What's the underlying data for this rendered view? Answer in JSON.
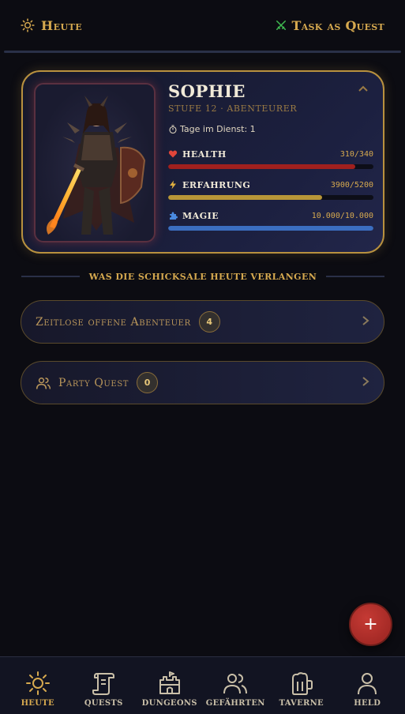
{
  "topbar": {
    "left_label": "Heute",
    "left_icon": "sun-icon",
    "right_label": "Task as Quest",
    "right_icon": "crossed-swords-icon"
  },
  "hero": {
    "name": "SOPHIE",
    "subtitle": "STUFE 12 · ABENTEURER",
    "days_label": "Tage im Dienst: 1",
    "collapse_icon": "chevron-up-icon",
    "stats": [
      {
        "label": "HEALTH",
        "value": "310/340",
        "fraction": 0.91,
        "color": "#a0201e",
        "icon": "heart-icon"
      },
      {
        "label": "ERFAHRUNG",
        "value": "3900/5200",
        "fraction": 0.75,
        "color": "#b89638",
        "icon": "lightning-icon"
      },
      {
        "label": "MAGIE",
        "value": "10.000/10.000",
        "fraction": 1.0,
        "color": "#3b6ec0",
        "icon": "puzzle-icon"
      }
    ]
  },
  "section_title": "WAS DIE SCHICKSALE HEUTE VERLANGEN",
  "adventures": {
    "label": "Zeitlose offene Abenteuer",
    "count": "4"
  },
  "party": {
    "label": "Party Quest",
    "count": "0",
    "icon": "people-icon"
  },
  "fab": {
    "label": "+"
  },
  "nav": [
    {
      "label": "HEUTE",
      "icon": "sun-icon",
      "active": true
    },
    {
      "label": "QUESTS",
      "icon": "scroll-icon",
      "active": false
    },
    {
      "label": "DUNGEONS",
      "icon": "castle-icon",
      "active": false
    },
    {
      "label": "GEFÄHRTEN",
      "icon": "people-icon",
      "active": false
    },
    {
      "label": "TAVERNE",
      "icon": "beer-mug-icon",
      "active": false
    },
    {
      "label": "HELD",
      "icon": "person-icon",
      "active": false
    }
  ]
}
